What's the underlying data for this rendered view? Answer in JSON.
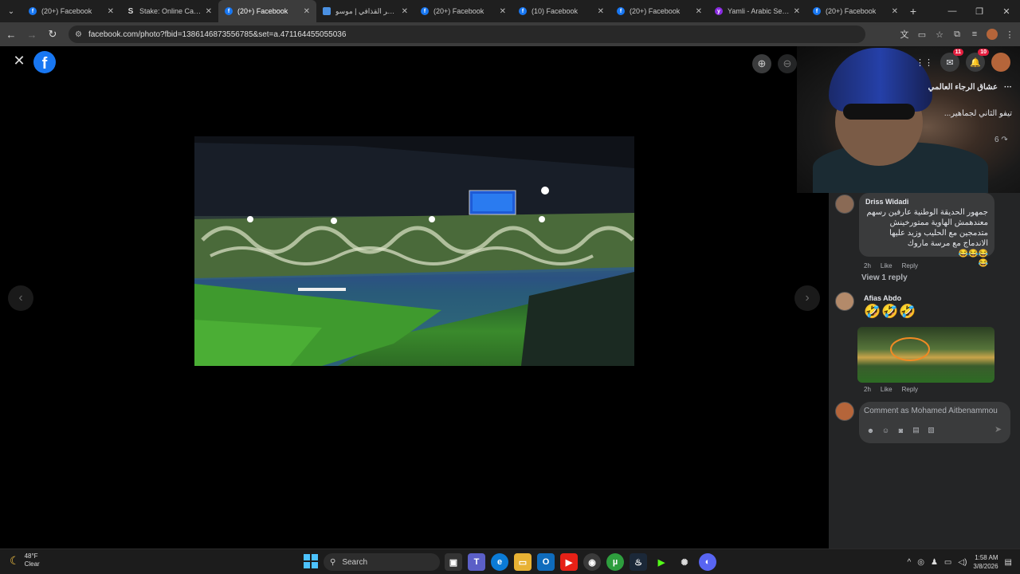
{
  "browser": {
    "tabs": [
      {
        "title": "(20+) Facebook",
        "icon": "facebook-icon",
        "active": false
      },
      {
        "title": "Stake: Online Casino",
        "icon": "stake-icon",
        "active": false
      },
      {
        "title": "(20+) Facebook",
        "icon": "facebook-icon",
        "active": true
      },
      {
        "title": "معمر القذافي | موسو...",
        "icon": "site-icon",
        "active": false
      },
      {
        "title": "(20+) Facebook",
        "icon": "facebook-icon",
        "active": false
      },
      {
        "title": "(10) Facebook",
        "icon": "facebook-icon",
        "active": false
      },
      {
        "title": "(20+) Facebook",
        "icon": "facebook-icon",
        "active": false
      },
      {
        "title": "Yamli - Arabic Search",
        "icon": "yamli-icon",
        "active": false
      },
      {
        "title": "(20+) Facebook",
        "icon": "facebook-icon",
        "active": false
      }
    ],
    "url": "facebook.com/photo?fbid=1386146873556785&set=a.471164455055036"
  },
  "facebook": {
    "logo_letter": "f",
    "messenger_badge": "11",
    "notifications_badge": "10",
    "page_name": "عشاق الرجاء العالمي",
    "post_text": "تيفو الثاني لجماهير...",
    "share_count": "6",
    "comments": [
      {
        "author": "Driss Widadi",
        "text": "جمهور الحديقة الوطنية عارفين رسهم معندهمش الهاوية ممتورخينش متدمجين مع الحليب وزيد عليها الاندماج مع مرسة ماروك",
        "emoji": "😂😂😂",
        "emoji2": "😂",
        "time": "2h",
        "like": "Like",
        "reply": "Reply"
      },
      {
        "author": "Afias Abdo",
        "emoji": "🤣🤣🤣",
        "time": "2h",
        "like": "Like",
        "reply": "Reply"
      }
    ],
    "view_replies": "View 1 reply",
    "comment_placeholder": "Comment as Mohamed Aitbenammou"
  },
  "taskbar": {
    "temperature": "48°F",
    "weather": "Clear",
    "search_label": "Search",
    "time": "1:58 AM",
    "date": "3/8/2026"
  }
}
